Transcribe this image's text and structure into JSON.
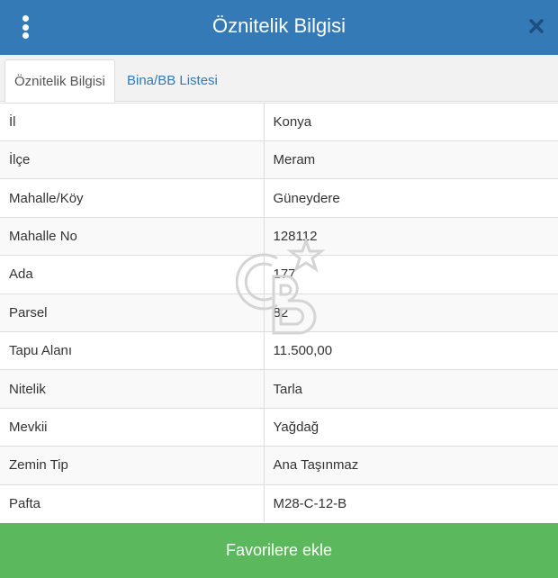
{
  "header": {
    "title": "Öznitelik Bilgisi",
    "menu_icon": "vertical-dots-icon",
    "close_icon": "close-icon",
    "background": "#337ab7"
  },
  "tabs": [
    {
      "label": "Öznitelik Bilgisi",
      "active": true
    },
    {
      "label": "Bina/BB Listesi",
      "active": false
    }
  ],
  "attributes": [
    {
      "label": "İl",
      "value": "Konya"
    },
    {
      "label": "İlçe",
      "value": "Meram"
    },
    {
      "label": "Mahalle/Köy",
      "value": "Güneydere"
    },
    {
      "label": "Mahalle No",
      "value": "128112"
    },
    {
      "label": "Ada",
      "value": "177"
    },
    {
      "label": "Parsel",
      "value": "82"
    },
    {
      "label": "Tapu Alanı",
      "value": "11.500,00"
    },
    {
      "label": "Nitelik",
      "value": "Tarla"
    },
    {
      "label": "Mevkii",
      "value": "Yağdağ"
    },
    {
      "label": "Zemin Tip",
      "value": "Ana Taşınmaz"
    },
    {
      "label": "Pafta",
      "value": "M28-C-12-B"
    }
  ],
  "watermark": {
    "icon": "cb-logo-watermark-icon"
  },
  "footer": {
    "favorite_label": "Favorilere ekle",
    "background": "#5cb85c"
  }
}
